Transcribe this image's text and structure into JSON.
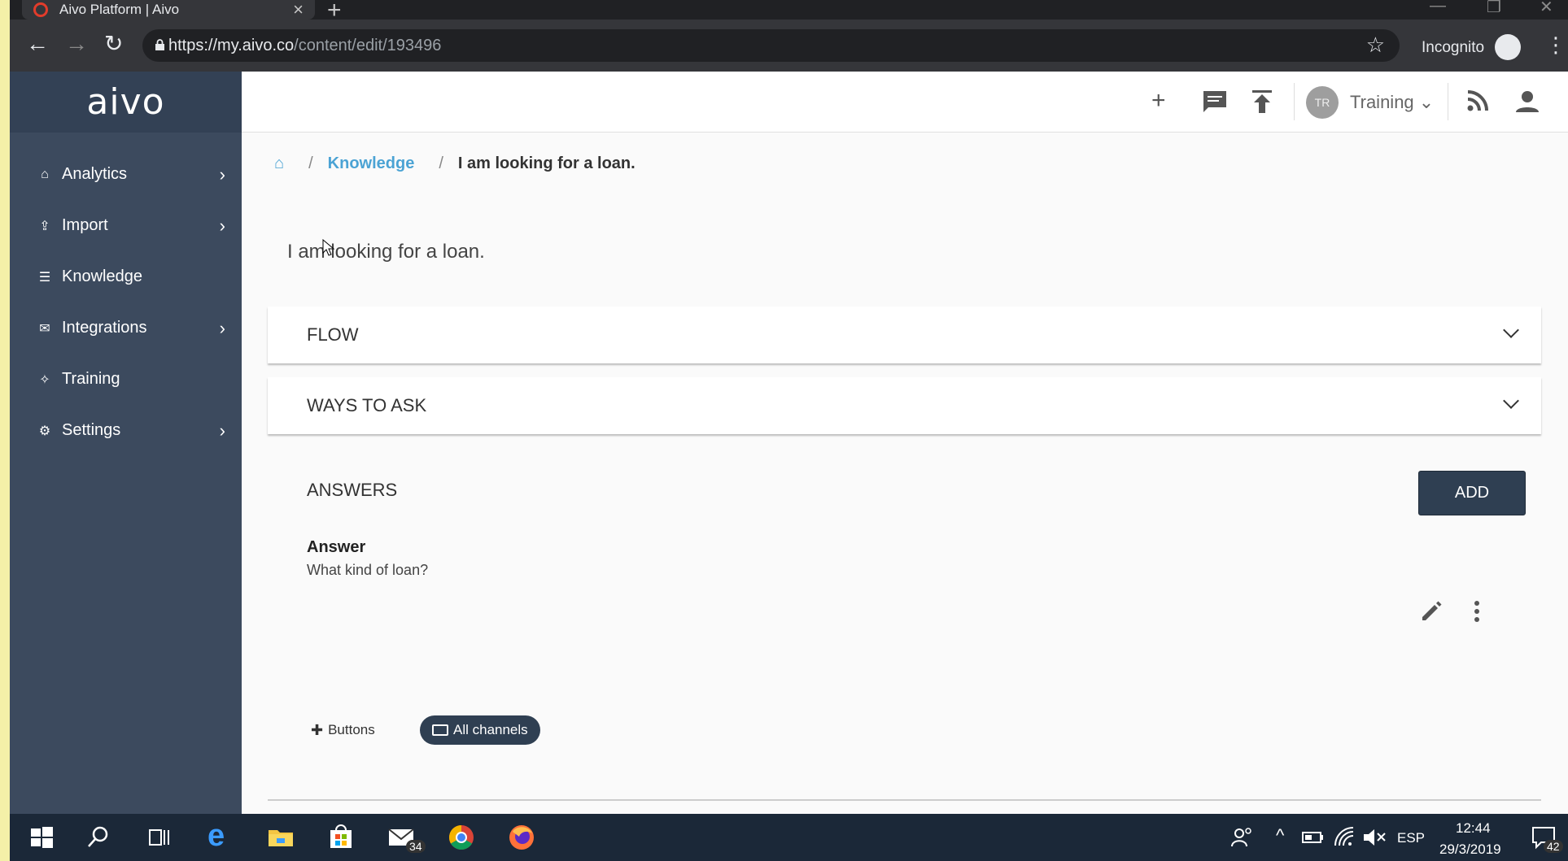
{
  "browser": {
    "tab_title": "Aivo Platform | Aivo",
    "tab_close": "×",
    "new_tab": "+",
    "url_host": "https://my.aivo.co",
    "url_path": "/content/edit/193496",
    "incognito_label": "Incognito",
    "minimize": "—",
    "maximize": "❐",
    "close": "✕"
  },
  "sidebar": {
    "logo": "aivo",
    "items": [
      {
        "label": "Analytics",
        "icon": "home-icon",
        "glyph": "⌂",
        "has_submenu": true
      },
      {
        "label": "Import",
        "icon": "upload-icon",
        "glyph": "⇪",
        "has_submenu": true
      },
      {
        "label": "Knowledge",
        "icon": "list-icon",
        "glyph": "☰",
        "has_submenu": false
      },
      {
        "label": "Integrations",
        "icon": "comments-icon",
        "glyph": "✉",
        "has_submenu": true
      },
      {
        "label": "Training",
        "icon": "lightbulb-icon",
        "glyph": "✧",
        "has_submenu": false
      },
      {
        "label": "Settings",
        "icon": "gear-icon",
        "glyph": "⚙",
        "has_submenu": true
      }
    ],
    "chevron": "›"
  },
  "topbar": {
    "avatar_initials": "TR",
    "project": "Training",
    "project_caret": "⌄"
  },
  "breadcrumb": {
    "home_glyph": "⌂",
    "separator": "/",
    "section": "Knowledge",
    "current": "I am looking for a loan."
  },
  "content": {
    "title": "I am looking for a loan.",
    "panels": [
      {
        "label": "FLOW"
      },
      {
        "label": "WAYS TO ASK"
      }
    ],
    "answers_title": "ANSWERS",
    "add_label": "ADD",
    "answer_label": "Answer",
    "answer_text": "What kind of loan?",
    "chip_buttons": "Buttons",
    "chip_all_channels": "All channels"
  },
  "taskbar": {
    "mail_badge": "34",
    "language": "ESP",
    "time": "12:44",
    "date": "29/3/2019",
    "notif_badge": "42"
  },
  "colors": {
    "sidebar": "#3c4a5e",
    "sidebar_logo_bg": "#334155",
    "accent_link": "#4ba3d4",
    "button_dark": "#2f3f52",
    "taskbar": "#1b2838"
  }
}
